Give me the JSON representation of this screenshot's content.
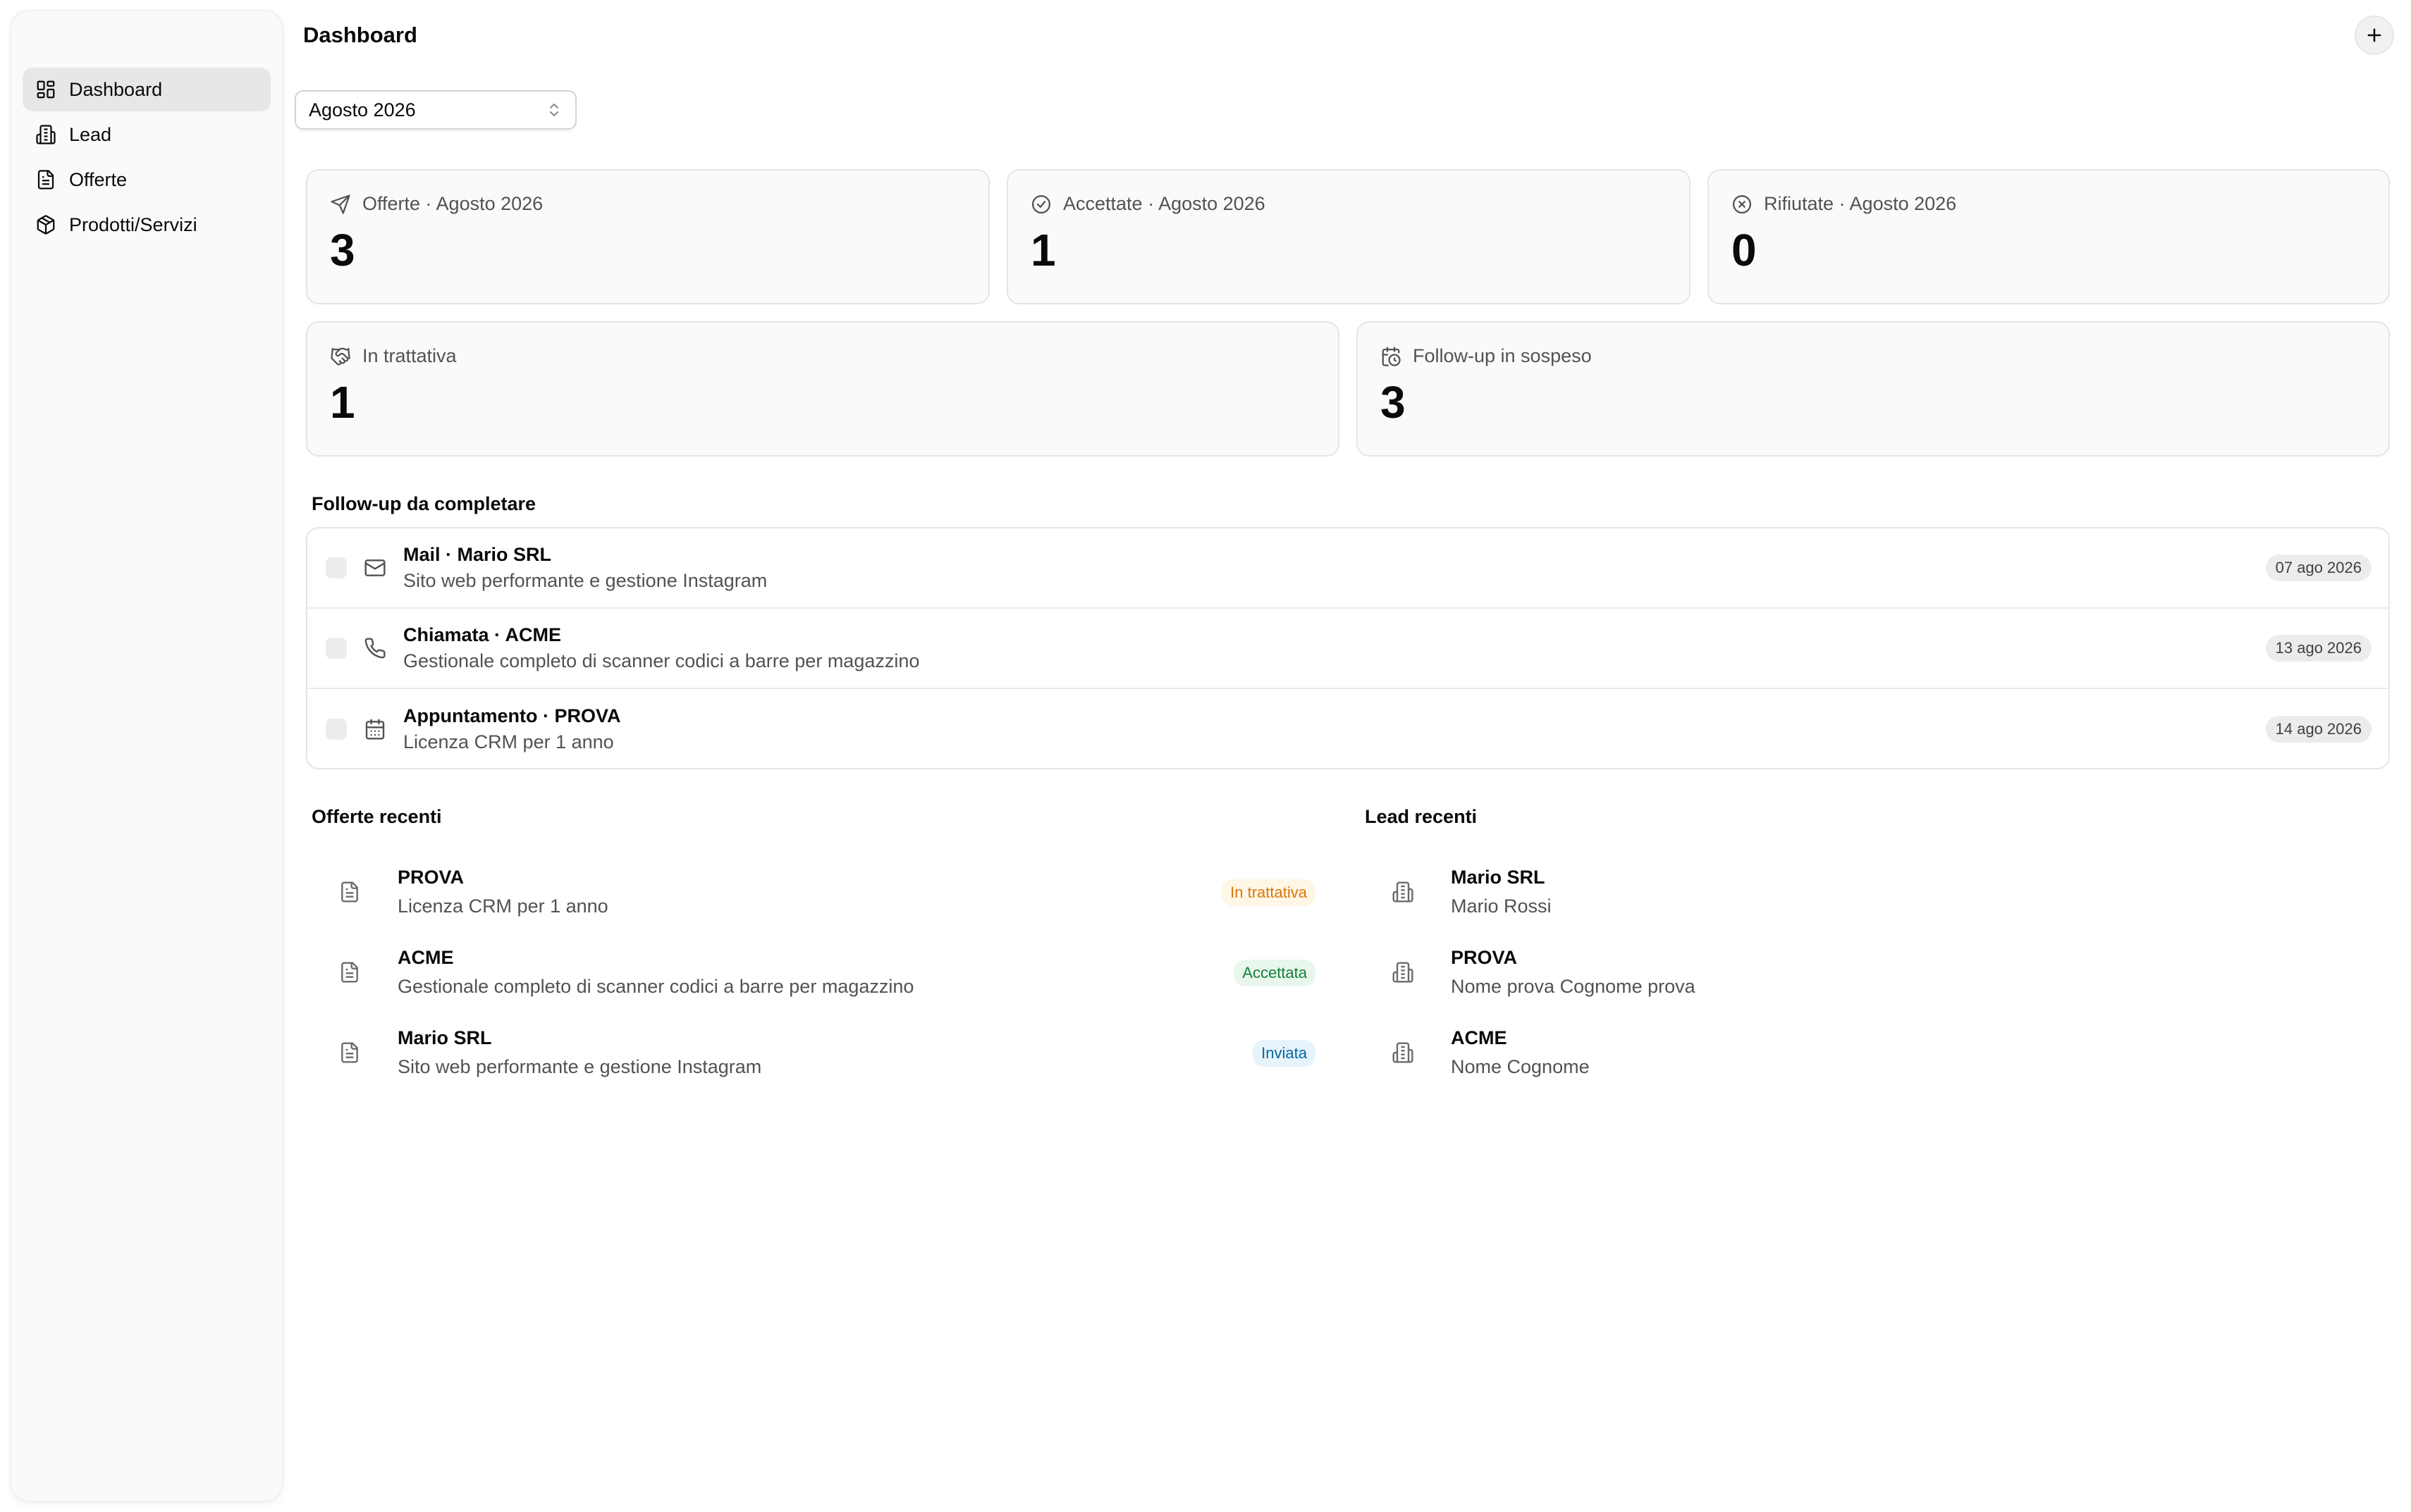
{
  "sidebar": {
    "items": [
      {
        "label": "Dashboard",
        "icon": "dashboard-grid-icon",
        "active": true
      },
      {
        "label": "Lead",
        "icon": "building-icon"
      },
      {
        "label": "Offerte",
        "icon": "document-icon"
      },
      {
        "label": "Prodotti/Servizi",
        "icon": "package-icon"
      }
    ]
  },
  "header": {
    "title": "Dashboard",
    "add_icon": "plus-icon"
  },
  "month_select": {
    "value": "Agosto 2026",
    "icon": "chevron-updown-icon"
  },
  "stats": [
    {
      "label": "Offerte · Agosto 2026",
      "value": "3",
      "icon": "send-icon"
    },
    {
      "label": "Accettate · Agosto 2026",
      "value": "1",
      "icon": "check-circle-icon"
    },
    {
      "label": "Rifiutate · Agosto 2026",
      "value": "0",
      "icon": "x-circle-icon"
    },
    {
      "label": "In trattativa",
      "value": "1",
      "icon": "handshake-icon"
    },
    {
      "label": "Follow-up in sospeso",
      "value": "3",
      "icon": "calendar-clock-icon"
    }
  ],
  "followups": {
    "title": "Follow-up da completare",
    "items": [
      {
        "title": "Mail · Mario SRL",
        "subtitle": "Sito web performante e gestione Instagram",
        "date": "07 ago 2026",
        "icon": "mail-icon"
      },
      {
        "title": "Chiamata · ACME",
        "subtitle": "Gestionale completo di scanner codici a barre per magazzino",
        "date": "13 ago 2026",
        "icon": "phone-icon"
      },
      {
        "title": "Appuntamento · PROVA",
        "subtitle": "Licenza CRM per 1 anno",
        "date": "14 ago 2026",
        "icon": "calendar-icon"
      }
    ]
  },
  "recent_offers": {
    "title": "Offerte recenti",
    "items": [
      {
        "title": "PROVA",
        "subtitle": "Licenza CRM per 1 anno",
        "status": "In trattativa",
        "status_color": "#d97706",
        "status_bg": "#fef7e6"
      },
      {
        "title": "ACME",
        "subtitle": "Gestionale completo di scanner codici a barre per magazzino",
        "status": "Accettata",
        "status_color": "#15803d",
        "status_bg": "#e8f6ec"
      },
      {
        "title": "Mario SRL",
        "subtitle": "Sito web performante e gestione Instagram",
        "status": "Inviata",
        "status_color": "#0369a1",
        "status_bg": "#e6f3fb"
      }
    ]
  },
  "recent_leads": {
    "title": "Lead recenti",
    "items": [
      {
        "title": "Mario SRL",
        "subtitle": "Mario Rossi"
      },
      {
        "title": "PROVA",
        "subtitle": "Nome prova Cognome prova"
      },
      {
        "title": "ACME",
        "subtitle": "Nome Cognome"
      }
    ]
  }
}
